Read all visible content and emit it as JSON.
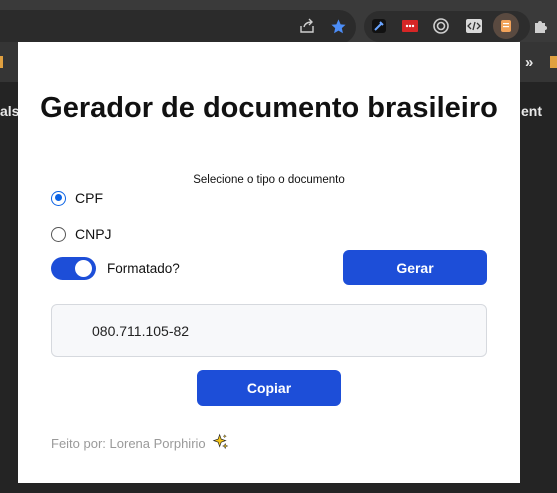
{
  "browser": {
    "share_icon": "share-icon",
    "bookmark_icon": "star-icon",
    "extensions": [
      "eyedropper-icon",
      "red-dots-icon",
      "target-icon",
      "code-icon",
      "orange-page-icon"
    ],
    "extensions_menu_icon": "puzzle-icon",
    "more_label": "»",
    "bg_left_text": "als",
    "bg_right_text": "ent"
  },
  "popup": {
    "title": "Gerador de documento brasileiro",
    "subtitle": "Selecione o tipo o documento",
    "radios": [
      {
        "label": "CPF",
        "checked": true
      },
      {
        "label": "CNPJ",
        "checked": false
      }
    ],
    "toggle": {
      "label": "Formatado?",
      "on": true
    },
    "generate_label": "Gerar",
    "output_value": "080.711.105-82",
    "copy_label": "Copiar",
    "footer": "Feito por: Lorena Porphirio",
    "footer_emoji": "sparkles-icon",
    "accent_color": "#1d4ed8"
  }
}
